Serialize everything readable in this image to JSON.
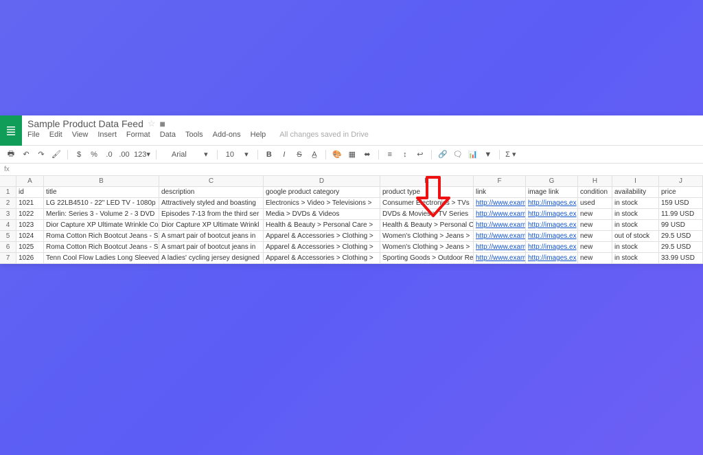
{
  "document_title": "Sample Product Data Feed",
  "save_status": "All changes saved in Drive",
  "menus": [
    "File",
    "Edit",
    "View",
    "Insert",
    "Format",
    "Data",
    "Tools",
    "Add-ons",
    "Help"
  ],
  "toolbar": {
    "font": "Arial",
    "size": "10"
  },
  "formula_label": "fx",
  "columns": [
    "A",
    "B",
    "C",
    "D",
    "E",
    "F",
    "G",
    "H",
    "I",
    "J"
  ],
  "row_numbers": [
    "1",
    "2",
    "3",
    "4",
    "5",
    "6",
    "7"
  ],
  "headers": {
    "id": "id",
    "title": "title",
    "description": "description",
    "google_product_category": "google product category",
    "product_type": "product type",
    "link": "link",
    "image_link": "image link",
    "condition": "condition",
    "availability": "availability",
    "price": "price"
  },
  "rows": [
    {
      "id": "1021",
      "title": "LG 22LB4510 - 22\" LED TV - 1080p",
      "description": "Attractively styled and boasting",
      "google_product_category": "Electronics > Video > Televisions >",
      "product_type": "Consumer Electronics > TVs",
      "link": "http://www.exam",
      "image_link": "http://images.ex",
      "condition": "used",
      "availability": "in stock",
      "price": "159 USD"
    },
    {
      "id": "1022",
      "title": "Merlin: Series 3 - Volume 2 - 3 DVD",
      "description": "Episodes 7-13 from the third ser",
      "google_product_category": "Media > DVDs & Videos",
      "product_type": "DVDs & Movies > TV Series",
      "link": "http://www.exam",
      "image_link": "http://images.ex",
      "condition": "new",
      "availability": "in stock",
      "price": "11.99 USD"
    },
    {
      "id": "1023",
      "title": "Dior Capture XP Ultimate Wrinkle Co",
      "description": "Dior Capture XP Ultimate Wrinkl",
      "google_product_category": "Health & Beauty > Personal Care >",
      "product_type": "Health & Beauty > Personal C",
      "link": "http://www.exam",
      "image_link": "http://images.ex",
      "condition": "new",
      "availability": "in stock",
      "price": "99 USD"
    },
    {
      "id": "1024",
      "title": "Roma Cotton Rich Bootcut Jeans - S",
      "description": "A smart pair of bootcut jeans in",
      "google_product_category": "Apparel & Accessories > Clothing >",
      "product_type": "Women's Clothing > Jeans >",
      "link": "http://www.exam",
      "image_link": "http://images.ex",
      "condition": "new",
      "availability": "out of stock",
      "price": "29.5 USD"
    },
    {
      "id": "1025",
      "title": "Roma Cotton Rich Bootcut Jeans - S",
      "description": "A smart pair of bootcut jeans in",
      "google_product_category": "Apparel & Accessories > Clothing >",
      "product_type": "Women's Clothing > Jeans >",
      "link": "http://www.exam",
      "image_link": "http://images.ex",
      "condition": "new",
      "availability": "in stock",
      "price": "29.5 USD"
    },
    {
      "id": "1026",
      "title": "Tenn Cool Flow Ladies Long Sleeved",
      "description": "A ladies' cycling jersey designed",
      "google_product_category": "Apparel & Accessories > Clothing >",
      "product_type": "Sporting Goods > Outdoor Re",
      "link": "http://www.exam",
      "image_link": "http://images.ex",
      "condition": "new",
      "availability": "in stock",
      "price": "33.99 USD"
    }
  ]
}
